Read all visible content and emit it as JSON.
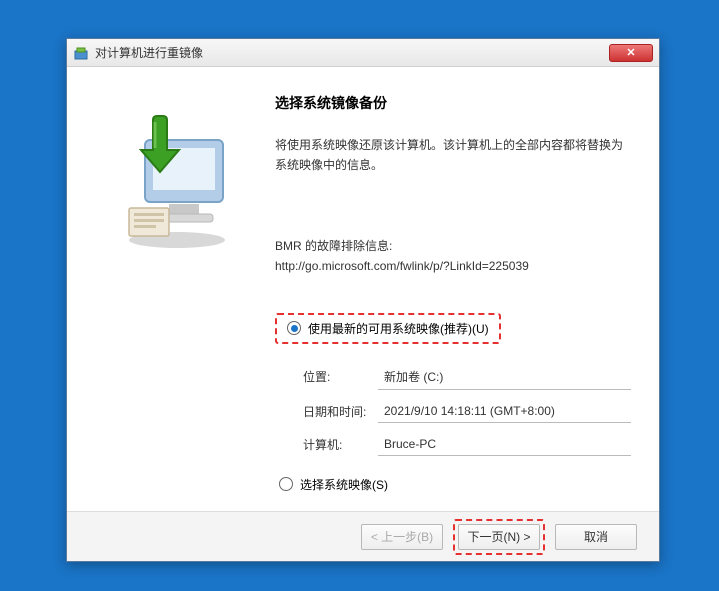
{
  "titlebar": {
    "title": "对计算机进行重镜像",
    "close": "✕"
  },
  "main": {
    "heading": "选择系统镜像备份",
    "desc": "将使用系统映像还原该计算机。该计算机上的全部内容都将替换为系统映像中的信息。",
    "troubleshoot_label": "BMR 的故障排除信息:",
    "troubleshoot_link": "http://go.microsoft.com/fwlink/p/?LinkId=225039",
    "radio1_label": "使用最新的可用系统映像(推荐)(U)",
    "radio2_label": "选择系统映像(S)",
    "fields": {
      "location_label": "位置:",
      "location_value": "新加卷 (C:)",
      "datetime_label": "日期和时间:",
      "datetime_value": "2021/9/10 14:18:11 (GMT+8:00)",
      "computer_label": "计算机:",
      "computer_value": "Bruce-PC"
    }
  },
  "buttons": {
    "back": "< 上一步(B)",
    "next": "下一页(N) >",
    "cancel": "取消"
  }
}
